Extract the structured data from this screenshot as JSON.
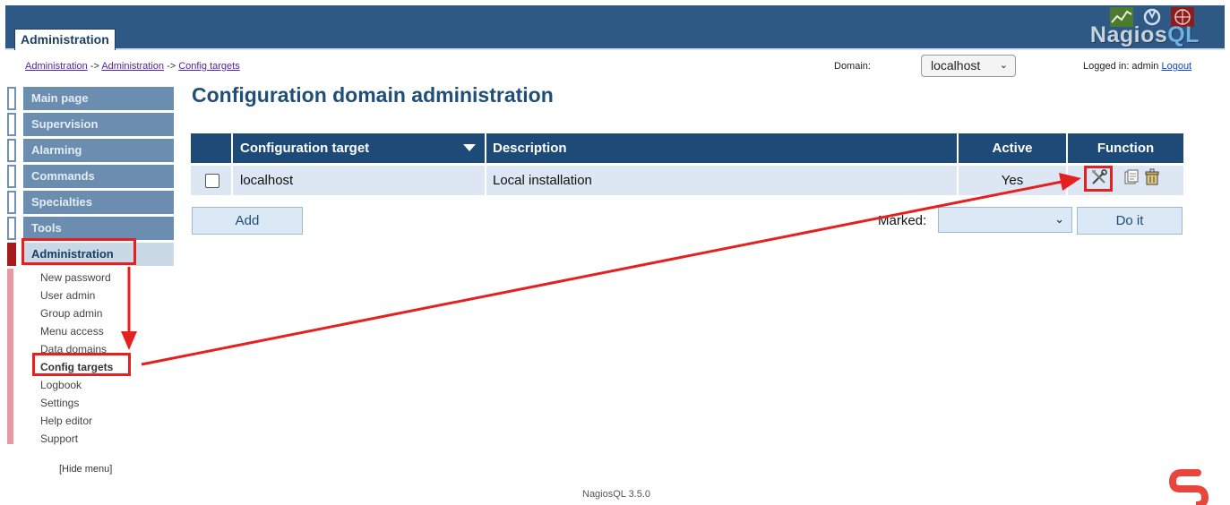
{
  "header": {
    "active_tab": "Administration",
    "logo_text": "Nagios",
    "logo_text_ql": "QL"
  },
  "breadcrumb": {
    "items": [
      "Administration",
      "Administration",
      "Config targets"
    ],
    "separator": "->"
  },
  "domain": {
    "label": "Domain:",
    "selected": "localhost"
  },
  "login": {
    "text": "Logged in: admin",
    "logout": "Logout"
  },
  "sidebar": {
    "items": [
      {
        "label": "Main page"
      },
      {
        "label": "Supervision"
      },
      {
        "label": "Alarming"
      },
      {
        "label": "Commands"
      },
      {
        "label": "Specialties"
      },
      {
        "label": "Tools"
      },
      {
        "label": "Administration"
      }
    ],
    "submenu": [
      {
        "label": "New password"
      },
      {
        "label": "User admin"
      },
      {
        "label": "Group admin"
      },
      {
        "label": "Menu access"
      },
      {
        "label": "Data domains"
      },
      {
        "label": "Config targets"
      },
      {
        "label": "Logbook"
      },
      {
        "label": "Settings"
      },
      {
        "label": "Help editor"
      },
      {
        "label": "Support"
      }
    ],
    "hide_menu": "[Hide menu]"
  },
  "main": {
    "title": "Configuration domain administration",
    "table": {
      "headers": [
        "Configuration target",
        "Description",
        "Active",
        "Function"
      ],
      "rows": [
        {
          "target": "localhost",
          "description": "Local installation",
          "active": "Yes"
        }
      ]
    },
    "add_label": "Add",
    "marked_label": "Marked:",
    "marked_value": "",
    "do_it_label": "Do it"
  },
  "footer": {
    "version": "NagiosQL 3.5.0"
  },
  "colors": {
    "header_bg": "#2e5984",
    "table_header": "#1d4a76",
    "annotation": "#e52020"
  },
  "icons": [
    "edit-tools-icon",
    "copy-icon",
    "delete-icon"
  ]
}
